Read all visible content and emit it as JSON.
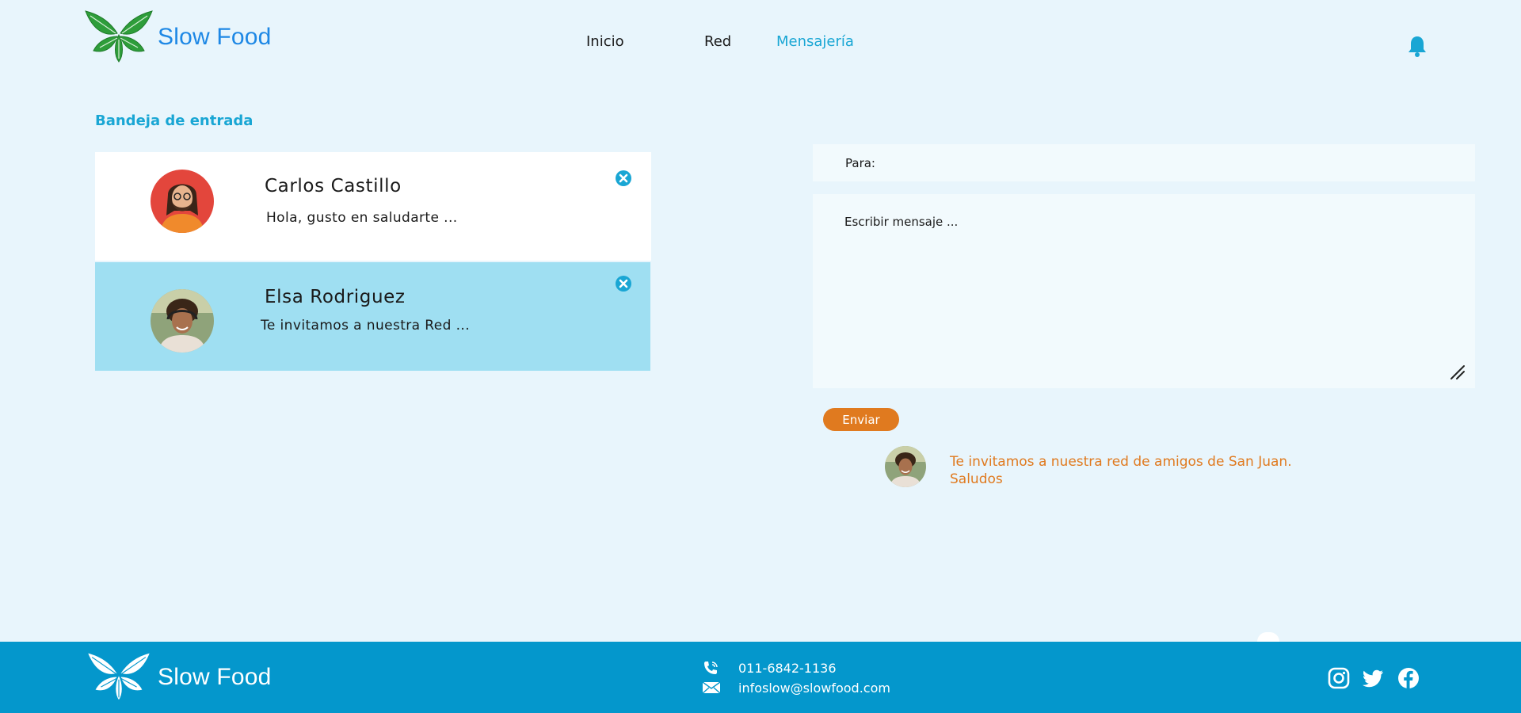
{
  "brand": {
    "name": "Slow Food"
  },
  "nav": {
    "items": [
      {
        "label": "Inicio",
        "active": false
      },
      {
        "label": "Red",
        "active": false
      },
      {
        "label": "Mensajería",
        "active": true
      }
    ],
    "notification_icon": "bell-icon"
  },
  "inbox": {
    "title": "Bandeja de entrada",
    "messages": [
      {
        "sender": "Carlos Castillo",
        "preview": "Hola, gusto en saludarte ...",
        "selected": false
      },
      {
        "sender": "Elsa Rodriguez",
        "preview": "Te invitamos a nuestra Red ...",
        "selected": true
      }
    ]
  },
  "compose": {
    "to_label": "Para:",
    "to_value": "",
    "message_placeholder": "Escribir mensaje ...",
    "send_label": "Enviar"
  },
  "sent_message": {
    "line1": "Te invitamos a nuestra red de amigos de San Juan.",
    "line2": "Saludos"
  },
  "footer": {
    "phone": "011-6842-1136",
    "email": "infoslow@slowfood.com",
    "social": [
      "instagram-icon",
      "twitter-icon",
      "facebook-icon"
    ]
  },
  "colors": {
    "background": "#e8f5fc",
    "accent": "#19a6d4",
    "brand_blue": "#1e88e5",
    "logo_green": "#2e9d3a",
    "send_orange": "#e07a1f",
    "selected_card": "#9fdff2",
    "footer": "#0497cc"
  }
}
